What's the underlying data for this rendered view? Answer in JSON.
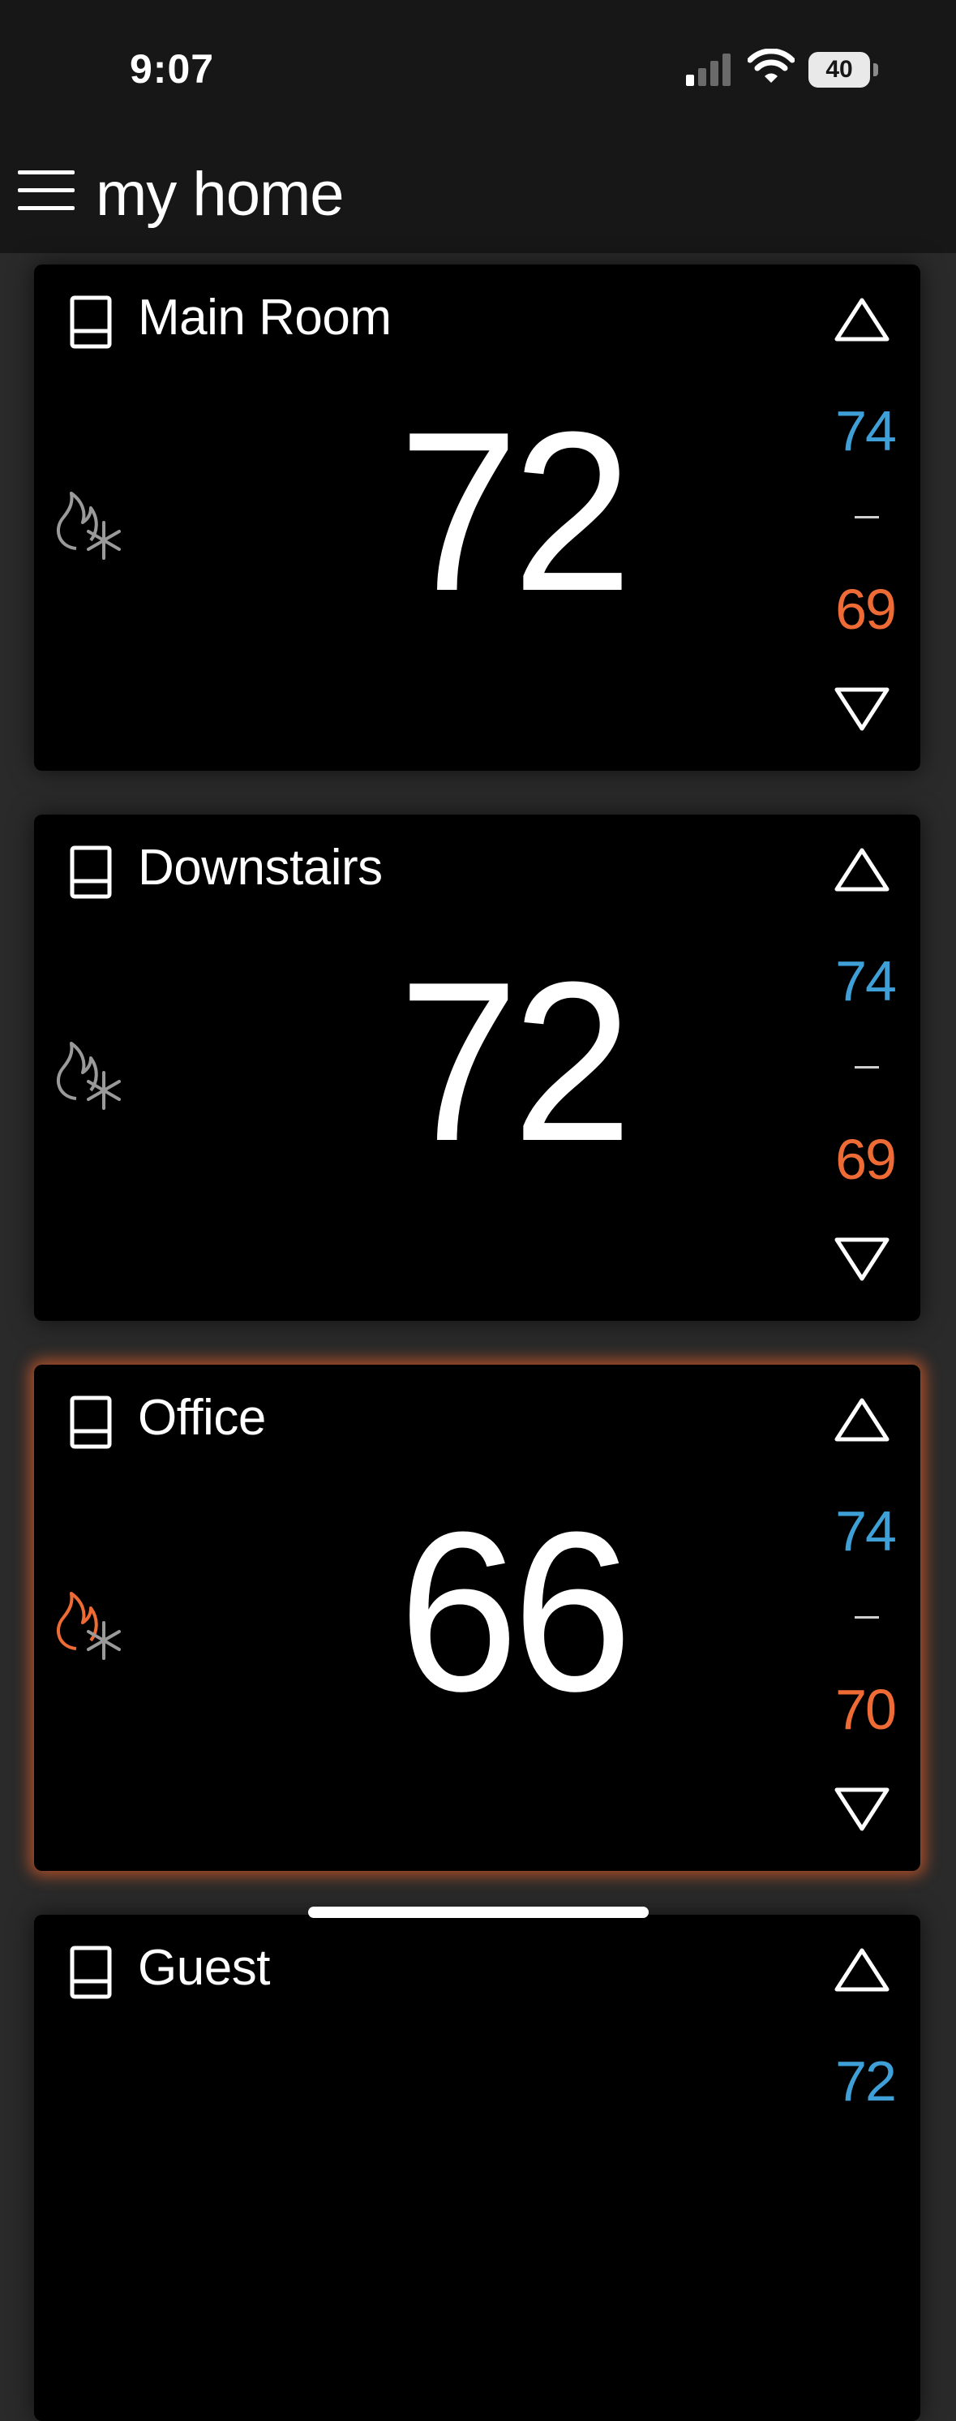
{
  "status_bar": {
    "time": "9:07",
    "battery": "40"
  },
  "header": {
    "title": "my home"
  },
  "thermostats": [
    {
      "name": "Main Room",
      "current": "72",
      "cool_setpoint": "74",
      "separator": "–",
      "heat_setpoint": "69",
      "mode": "heat-cool",
      "heating_active": false
    },
    {
      "name": "Downstairs",
      "current": "72",
      "cool_setpoint": "74",
      "separator": "–",
      "heat_setpoint": "69",
      "mode": "heat-cool",
      "heating_active": false
    },
    {
      "name": "Office",
      "current": "66",
      "cool_setpoint": "74",
      "separator": "–",
      "heat_setpoint": "70",
      "mode": "heat-cool",
      "heating_active": true
    },
    {
      "name": "Guest",
      "current": "",
      "cool_setpoint": "72",
      "separator": "–",
      "heat_setpoint": "",
      "mode": "heat-cool",
      "heating_active": false
    }
  ],
  "colors": {
    "cool": "#3fa0d8",
    "heat": "#ee6b35",
    "card_bg": "#000000",
    "page_bg": "#2a2a2a",
    "header_bg": "#171717"
  },
  "icons": [
    "signal-icon",
    "wifi-icon",
    "battery-icon",
    "menu-icon",
    "thermostat-device-icon",
    "flame-icon",
    "snowflake-icon",
    "arrow-up-icon",
    "arrow-down-icon"
  ]
}
